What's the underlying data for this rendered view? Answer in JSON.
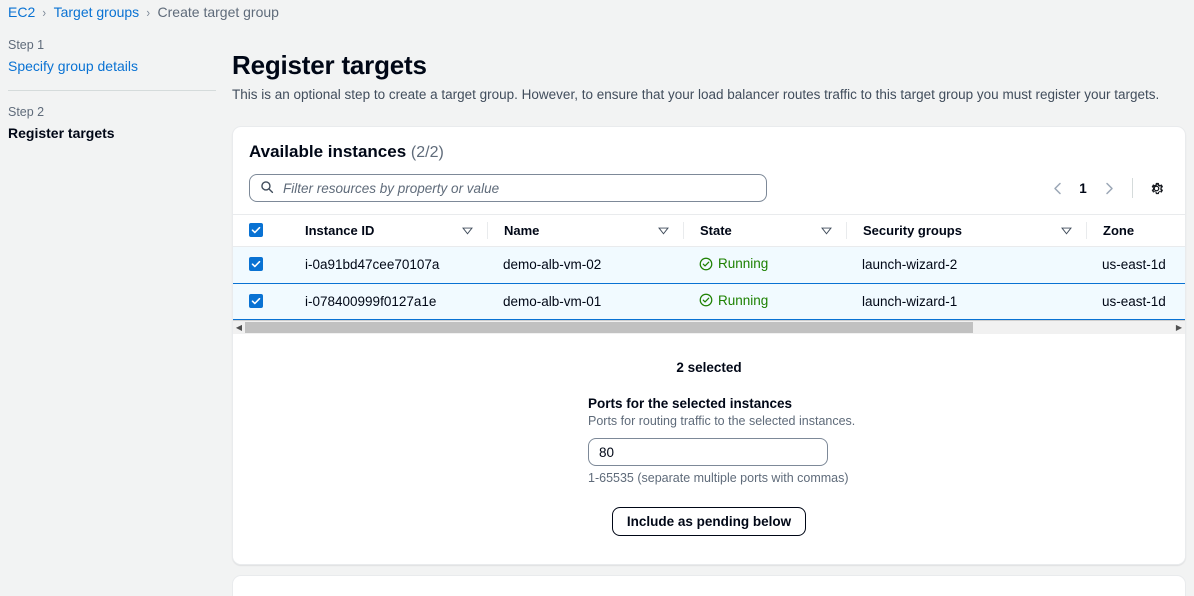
{
  "breadcrumb": {
    "items": [
      {
        "label": "EC2",
        "type": "link"
      },
      {
        "label": "Target groups",
        "type": "link"
      },
      {
        "label": "Create target group",
        "type": "current"
      }
    ],
    "separator": "›"
  },
  "wizard": {
    "steps": [
      {
        "number": "Step 1",
        "label": "Specify group details",
        "state": "link"
      },
      {
        "number": "Step 2",
        "label": "Register targets",
        "state": "active"
      }
    ]
  },
  "page": {
    "title": "Register targets",
    "description": "This is an optional step to create a target group. However, to ensure that your load balancer routes traffic to this target group you must register your targets."
  },
  "instances_panel": {
    "title": "Available instances",
    "count": "(2/2)",
    "search": {
      "placeholder": "Filter resources by property or value",
      "value": "",
      "icon": "search-icon"
    },
    "pagination": {
      "prev_icon": "chevron-left-icon",
      "next_icon": "chevron-right-icon",
      "page": "1"
    },
    "settings_icon": "gear-icon",
    "table": {
      "columns": [
        {
          "label": "Instance ID",
          "sortable": true
        },
        {
          "label": "Name",
          "sortable": true
        },
        {
          "label": "State",
          "sortable": true
        },
        {
          "label": "Security groups",
          "sortable": true
        },
        {
          "label": "Zone",
          "sortable": false
        }
      ],
      "rows": [
        {
          "selected": true,
          "instance_id": "i-0a91bd47cee70107a",
          "name": "demo-alb-vm-02",
          "state": "Running",
          "security_groups": "launch-wizard-2",
          "zone": "us-east-1d"
        },
        {
          "selected": true,
          "instance_id": "i-078400999f0127a1e",
          "name": "demo-alb-vm-01",
          "state": "Running",
          "security_groups": "launch-wizard-1",
          "zone": "us-east-1d"
        }
      ]
    },
    "selection_summary": "2 selected",
    "ports_field": {
      "label": "Ports for the selected instances",
      "description": "Ports for routing traffic to the selected instances.",
      "value": "80",
      "hint": "1-65535 (separate multiple ports with commas)"
    },
    "include_button": "Include as pending below"
  },
  "colors": {
    "link": "#0972d3",
    "accent": "#0972d3",
    "status_running": "#1d8102",
    "selected_row_bg": "#f1faff",
    "page_bg": "#f2f3f3"
  }
}
